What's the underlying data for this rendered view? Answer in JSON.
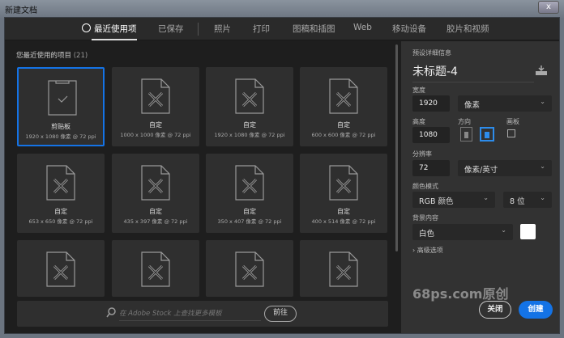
{
  "window": {
    "title": "新建文档",
    "close": "x"
  },
  "tabs": [
    {
      "label": "最近使用项",
      "icon": "clock-icon",
      "active": true
    },
    {
      "label": "已保存"
    },
    {
      "label": "照片"
    },
    {
      "label": "打印"
    },
    {
      "label": "图稿和插图"
    },
    {
      "label": "Web"
    },
    {
      "label": "移动设备"
    },
    {
      "label": "胶片和视频"
    }
  ],
  "recent": {
    "title": "您最近使用的项目",
    "count": "(21)",
    "items": [
      {
        "name": "剪贴板",
        "size": "1920 x 1080 像素 @ 72 ppi",
        "icon": "clipboard-icon",
        "selected": true
      },
      {
        "name": "自定",
        "size": "1000 x 1000 像素 @ 72 ppi"
      },
      {
        "name": "自定",
        "size": "1920 x 1080 像素 @ 72 ppi"
      },
      {
        "name": "自定",
        "size": "600 x 600 像素 @ 72 ppi"
      },
      {
        "name": "自定",
        "size": "653 x 650 像素 @ 72 ppi"
      },
      {
        "name": "自定",
        "size": "435 x 397 像素 @ 72 ppi"
      },
      {
        "name": "自定",
        "size": "350 x 407 像素 @ 72 ppi"
      },
      {
        "name": "自定",
        "size": "400 x 514 像素 @ 72 ppi"
      },
      {
        "name": "",
        "size": ""
      },
      {
        "name": "",
        "size": ""
      },
      {
        "name": "",
        "size": ""
      },
      {
        "name": "",
        "size": ""
      }
    ]
  },
  "search": {
    "placeholder": "在 Adobe Stock 上查找更多模板",
    "go": "前往"
  },
  "preset": {
    "header": "预设详细信息",
    "doc_title": "未标题-4",
    "width_label": "宽度",
    "width": "1920",
    "width_unit": "像素",
    "height_label": "高度",
    "height": "1080",
    "orientation_label": "方向",
    "artboard_label": "画板",
    "resolution_label": "分辨率",
    "resolution": "72",
    "resolution_unit": "像素/英寸",
    "color_mode_label": "颜色模式",
    "color_mode": "RGB 颜色",
    "bit_depth": "8 位",
    "background_label": "背景内容",
    "background": "白色",
    "background_color": "#ffffff",
    "advanced": "高级选项",
    "orientation": "landscape",
    "artboard_checked": false
  },
  "watermark": "68ps.com原创",
  "buttons": {
    "close": "关闭",
    "create": "创建"
  },
  "colors": {
    "accent": "#1473e6"
  }
}
